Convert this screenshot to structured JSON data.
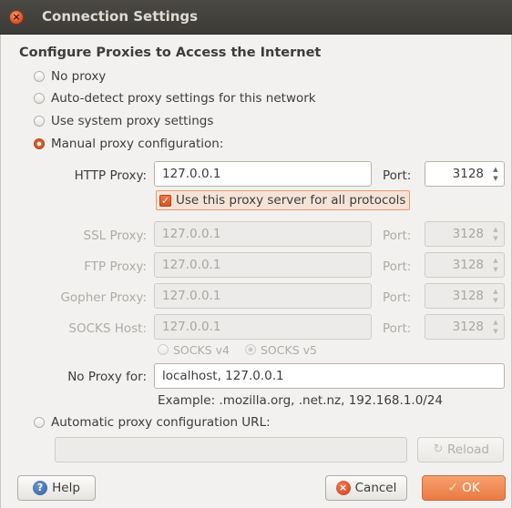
{
  "window": {
    "title": "Connection Settings",
    "close_glyph": "×"
  },
  "section_title": "Configure Proxies to Access the Internet",
  "radios": {
    "no_proxy": "No proxy",
    "auto_detect": "Auto-detect proxy settings for this network",
    "system": "Use system proxy settings",
    "manual": "Manual proxy configuration:",
    "auto_url": "Automatic proxy configuration URL:"
  },
  "selected_mode": "manual",
  "proxies": {
    "http": {
      "label": "HTTP Proxy:",
      "value": "127.0.0.1",
      "port_label": "Port:",
      "port": "3128"
    },
    "ssl": {
      "label": "SSL Proxy:",
      "value": "127.0.0.1",
      "port_label": "Port:",
      "port": "3128"
    },
    "ftp": {
      "label": "FTP Proxy:",
      "value": "127.0.0.1",
      "port_label": "Port:",
      "port": "3128"
    },
    "gopher": {
      "label": "Gopher Proxy:",
      "value": "127.0.0.1",
      "port_label": "Port:",
      "port": "3128"
    },
    "socks": {
      "label": "SOCKS Host:",
      "value": "127.0.0.1",
      "port_label": "Port:",
      "port": "3128"
    }
  },
  "use_for_all": {
    "label": "Use this proxy server for all protocols",
    "checked": true
  },
  "socks_versions": {
    "v4": "SOCKS v4",
    "v5": "SOCKS v5",
    "selected": "v5"
  },
  "no_proxy_for": {
    "label": "No Proxy for:",
    "value": "localhost, 127.0.0.1"
  },
  "example": "Example: .mozilla.org, .net.nz, 192.168.1.0/24",
  "auto_url": {
    "value": "",
    "reload_label": "Reload"
  },
  "buttons": {
    "help": "Help",
    "cancel": "Cancel",
    "ok": "OK"
  },
  "icons": {
    "help": "help-icon",
    "cancel": "cancel-icon",
    "ok": "ok-check-icon",
    "reload": "reload-icon"
  },
  "colors": {
    "accent": "#e0642c",
    "titlebar": "#3c3b37",
    "ok_button": "#ea7a43"
  }
}
